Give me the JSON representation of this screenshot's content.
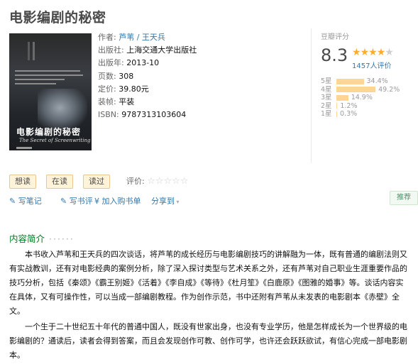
{
  "book": {
    "title": "电影编剧的秘密",
    "cover": {
      "title": "电影编剧的秘密",
      "subtitle": "The Secret of Screenwriting"
    },
    "info": {
      "author_label": "作者:",
      "authors": "芦苇 / 王天兵",
      "publisher_label": "出版社:",
      "publisher": "上海交通大学出版社",
      "pubdate_label": "出版年:",
      "pubdate": "2013-10",
      "pages_label": "页数:",
      "pages": "308",
      "price_label": "定价:",
      "price": "39.80元",
      "binding_label": "装帧:",
      "binding": "平装",
      "isbn_label": "ISBN:",
      "isbn": "9787313103604"
    }
  },
  "rating": {
    "label": "豆瓣评分",
    "score": "8.3",
    "stars": 4,
    "count_text": "1457人评价",
    "distribution": [
      {
        "label": "5星",
        "percent": 34.4,
        "text": "34.4%"
      },
      {
        "label": "4星",
        "percent": 49.2,
        "text": "49.2%"
      },
      {
        "label": "3星",
        "percent": 14.9,
        "text": "14.9%"
      },
      {
        "label": "2星",
        "percent": 1.2,
        "text": "1.2%"
      },
      {
        "label": "1星",
        "percent": 0.3,
        "text": "0.3%"
      }
    ]
  },
  "actions": {
    "want": "想读",
    "reading": "在读",
    "read": "读过",
    "evaluate_label": "评价:",
    "evaluate_stars": "☆☆☆☆☆"
  },
  "links": {
    "write_note": "写笔记",
    "write_review": "写书评",
    "add_cart": "加入购书单",
    "share": "分享到",
    "recommend": "推荐"
  },
  "intro": {
    "title": "内容简介",
    "dots": "······",
    "paragraphs": [
      "本书收入芦苇和王天兵的四次谈话，将芦苇的成长经历与电影编剧技巧的讲解融为一体，既有普通的编剧法则又有实战教训，还有对电影经典的案例分析，除了深入探讨类型与艺术关系之外，还有芦苇对自己职业生涯重要作品的技巧分析，包括《秦颂》《霸王别姬》《活着》《李自成》《等待》《杜月笙》《白鹿原》《图雅的婚事》等。谈话内容实在具体，又有可操作性，可以当成一部编剧教程。作为创作示范，书中还附有芦苇从未发表的电影剧本《赤壁》全文。",
      "一个生于二十世纪五十年代的普通中国人，既没有世家出身，也没有专业学历，他是怎样成长为一个世界级的电影编剧的？通读后，读者会得到答案，而且会发现创作可教、创作可学，也许还会跃跃欲试，有信心完成一部电影剧本。"
    ]
  },
  "colors": {
    "link": "#3377aa",
    "section_title": "#007722",
    "star": "#ffac2d",
    "bar": "#ffd596",
    "button_bg": "#fff3d9"
  }
}
